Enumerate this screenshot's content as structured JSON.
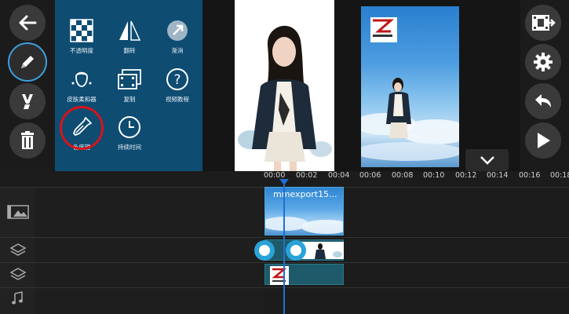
{
  "left_toolbar": {
    "buttons": [
      {
        "name": "back",
        "icon": "arrow-left-icon"
      },
      {
        "name": "edit",
        "icon": "pencil-icon",
        "selected": true
      },
      {
        "name": "effects",
        "icon": "brush-icon"
      },
      {
        "name": "delete",
        "icon": "trash-icon"
      }
    ]
  },
  "tools_panel": {
    "items": [
      {
        "label": "不透明度",
        "icon": "checkerboard-icon"
      },
      {
        "label": "翻转",
        "icon": "flip-icon"
      },
      {
        "label": "渐消",
        "icon": "fade-icon"
      },
      {
        "label": "皮肤柔和器",
        "icon": "face-icon"
      },
      {
        "label": "复制",
        "icon": "duplicate-icon"
      },
      {
        "label": "视频教程",
        "icon": "help-icon"
      },
      {
        "label": "色度键",
        "icon": "eyedropper-icon",
        "highlighted": true
      },
      {
        "label": "持续时间",
        "icon": "clock-icon"
      }
    ]
  },
  "right_toolbar": {
    "buttons": [
      {
        "name": "export",
        "icon": "film-export-icon"
      },
      {
        "name": "settings",
        "icon": "gear-icon"
      },
      {
        "name": "undo",
        "icon": "undo-icon"
      },
      {
        "name": "play",
        "icon": "play-icon"
      }
    ]
  },
  "timeline": {
    "ticks": [
      "00:00",
      "00:02",
      "00:04",
      "00:06",
      "00:08",
      "00:10",
      "00:12",
      "00:14",
      "00:16",
      "00:18"
    ],
    "clips": [
      {
        "name": "video-clip",
        "title": "mmexport15..."
      },
      {
        "name": "overlay-clip-1"
      },
      {
        "name": "overlay-clip-2"
      }
    ]
  },
  "colors": {
    "accent": "#29a3d8",
    "panel": "#0e4c72",
    "highlight_ring": "#d7141a",
    "playhead": "#1f6fd1"
  }
}
